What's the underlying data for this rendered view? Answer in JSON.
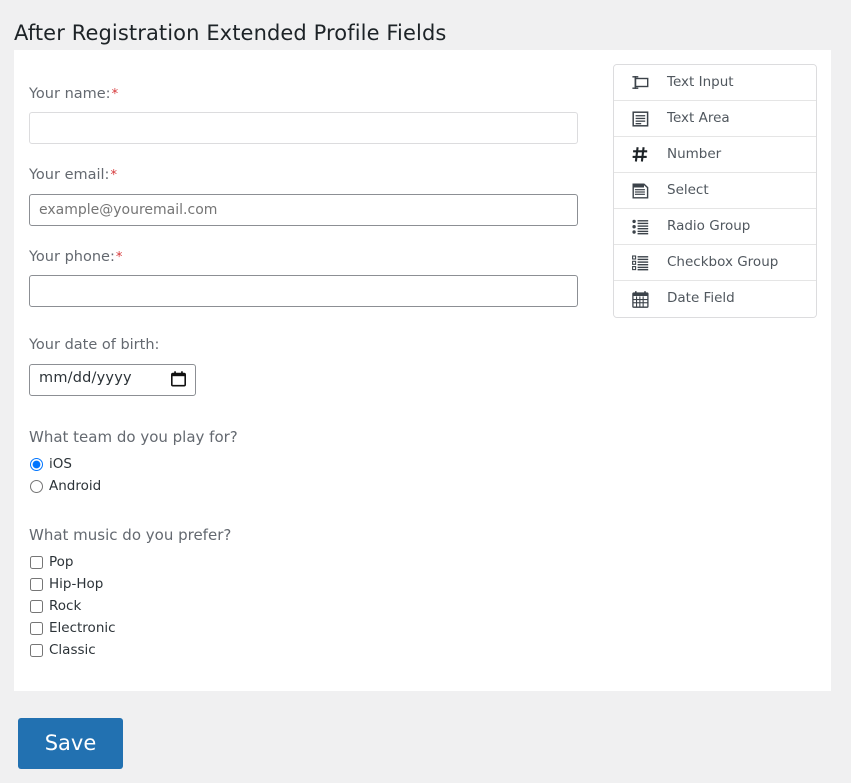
{
  "page": {
    "title": "After Registration Extended Profile Fields",
    "background_color": "#f0f0f1"
  },
  "form": {
    "fields": [
      {
        "label": "Your name:",
        "required": true,
        "required_marker": "*",
        "type": "text",
        "value": "",
        "placeholder": ""
      },
      {
        "label": "Your email:",
        "required": true,
        "required_marker": "*",
        "type": "email",
        "value": "",
        "placeholder": "example@youremail.com"
      },
      {
        "label": "Your phone:",
        "required": true,
        "required_marker": "*",
        "type": "text",
        "value": "",
        "placeholder": ""
      }
    ],
    "date_field": {
      "label": "Your date of birth:",
      "required": false,
      "type": "date",
      "value": "",
      "placeholder": "mm/dd/yyyy",
      "icon": "calendar-icon"
    },
    "radio_group": {
      "label": "What team do you play for?",
      "options": [
        {
          "label": "iOS",
          "checked": true
        },
        {
          "label": "Android",
          "checked": false
        }
      ]
    },
    "checkbox_group": {
      "label": "What music do you prefer?",
      "options": [
        {
          "label": "Pop",
          "checked": false
        },
        {
          "label": "Hip-Hop",
          "checked": false
        },
        {
          "label": "Rock",
          "checked": false
        },
        {
          "label": "Electronic",
          "checked": false
        },
        {
          "label": "Classic",
          "checked": false
        }
      ]
    }
  },
  "palette": {
    "items": [
      {
        "label": "Text Input",
        "icon": "text-input-icon"
      },
      {
        "label": "Text Area",
        "icon": "text-area-icon"
      },
      {
        "label": "Number",
        "icon": "number-hash-icon"
      },
      {
        "label": "Select",
        "icon": "select-dropdown-icon"
      },
      {
        "label": "Radio Group",
        "icon": "radio-group-icon"
      },
      {
        "label": "Checkbox Group",
        "icon": "checkbox-group-icon"
      },
      {
        "label": "Date Field",
        "icon": "calendar-icon"
      }
    ]
  },
  "actions": {
    "save_label": "Save",
    "save_color": "#2271b1"
  },
  "colors": {
    "required_asterisk": "#d63638",
    "label_text": "#646970",
    "card_background": "#ffffff",
    "accent": "#2271b1"
  }
}
